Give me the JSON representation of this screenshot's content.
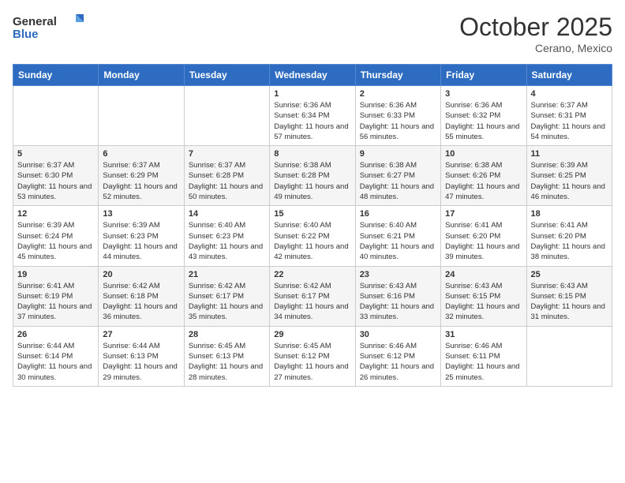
{
  "header": {
    "logo_line1": "General",
    "logo_line2": "Blue",
    "month": "October 2025",
    "location": "Cerano, Mexico"
  },
  "days_of_week": [
    "Sunday",
    "Monday",
    "Tuesday",
    "Wednesday",
    "Thursday",
    "Friday",
    "Saturday"
  ],
  "weeks": [
    [
      {
        "day": "",
        "sunrise": "",
        "sunset": "",
        "daylight": ""
      },
      {
        "day": "",
        "sunrise": "",
        "sunset": "",
        "daylight": ""
      },
      {
        "day": "",
        "sunrise": "",
        "sunset": "",
        "daylight": ""
      },
      {
        "day": "1",
        "sunrise": "Sunrise: 6:36 AM",
        "sunset": "Sunset: 6:34 PM",
        "daylight": "Daylight: 11 hours and 57 minutes."
      },
      {
        "day": "2",
        "sunrise": "Sunrise: 6:36 AM",
        "sunset": "Sunset: 6:33 PM",
        "daylight": "Daylight: 11 hours and 56 minutes."
      },
      {
        "day": "3",
        "sunrise": "Sunrise: 6:36 AM",
        "sunset": "Sunset: 6:32 PM",
        "daylight": "Daylight: 11 hours and 55 minutes."
      },
      {
        "day": "4",
        "sunrise": "Sunrise: 6:37 AM",
        "sunset": "Sunset: 6:31 PM",
        "daylight": "Daylight: 11 hours and 54 minutes."
      }
    ],
    [
      {
        "day": "5",
        "sunrise": "Sunrise: 6:37 AM",
        "sunset": "Sunset: 6:30 PM",
        "daylight": "Daylight: 11 hours and 53 minutes."
      },
      {
        "day": "6",
        "sunrise": "Sunrise: 6:37 AM",
        "sunset": "Sunset: 6:29 PM",
        "daylight": "Daylight: 11 hours and 52 minutes."
      },
      {
        "day": "7",
        "sunrise": "Sunrise: 6:37 AM",
        "sunset": "Sunset: 6:28 PM",
        "daylight": "Daylight: 11 hours and 50 minutes."
      },
      {
        "day": "8",
        "sunrise": "Sunrise: 6:38 AM",
        "sunset": "Sunset: 6:28 PM",
        "daylight": "Daylight: 11 hours and 49 minutes."
      },
      {
        "day": "9",
        "sunrise": "Sunrise: 6:38 AM",
        "sunset": "Sunset: 6:27 PM",
        "daylight": "Daylight: 11 hours and 48 minutes."
      },
      {
        "day": "10",
        "sunrise": "Sunrise: 6:38 AM",
        "sunset": "Sunset: 6:26 PM",
        "daylight": "Daylight: 11 hours and 47 minutes."
      },
      {
        "day": "11",
        "sunrise": "Sunrise: 6:39 AM",
        "sunset": "Sunset: 6:25 PM",
        "daylight": "Daylight: 11 hours and 46 minutes."
      }
    ],
    [
      {
        "day": "12",
        "sunrise": "Sunrise: 6:39 AM",
        "sunset": "Sunset: 6:24 PM",
        "daylight": "Daylight: 11 hours and 45 minutes."
      },
      {
        "day": "13",
        "sunrise": "Sunrise: 6:39 AM",
        "sunset": "Sunset: 6:23 PM",
        "daylight": "Daylight: 11 hours and 44 minutes."
      },
      {
        "day": "14",
        "sunrise": "Sunrise: 6:40 AM",
        "sunset": "Sunset: 6:23 PM",
        "daylight": "Daylight: 11 hours and 43 minutes."
      },
      {
        "day": "15",
        "sunrise": "Sunrise: 6:40 AM",
        "sunset": "Sunset: 6:22 PM",
        "daylight": "Daylight: 11 hours and 42 minutes."
      },
      {
        "day": "16",
        "sunrise": "Sunrise: 6:40 AM",
        "sunset": "Sunset: 6:21 PM",
        "daylight": "Daylight: 11 hours and 40 minutes."
      },
      {
        "day": "17",
        "sunrise": "Sunrise: 6:41 AM",
        "sunset": "Sunset: 6:20 PM",
        "daylight": "Daylight: 11 hours and 39 minutes."
      },
      {
        "day": "18",
        "sunrise": "Sunrise: 6:41 AM",
        "sunset": "Sunset: 6:20 PM",
        "daylight": "Daylight: 11 hours and 38 minutes."
      }
    ],
    [
      {
        "day": "19",
        "sunrise": "Sunrise: 6:41 AM",
        "sunset": "Sunset: 6:19 PM",
        "daylight": "Daylight: 11 hours and 37 minutes."
      },
      {
        "day": "20",
        "sunrise": "Sunrise: 6:42 AM",
        "sunset": "Sunset: 6:18 PM",
        "daylight": "Daylight: 11 hours and 36 minutes."
      },
      {
        "day": "21",
        "sunrise": "Sunrise: 6:42 AM",
        "sunset": "Sunset: 6:17 PM",
        "daylight": "Daylight: 11 hours and 35 minutes."
      },
      {
        "day": "22",
        "sunrise": "Sunrise: 6:42 AM",
        "sunset": "Sunset: 6:17 PM",
        "daylight": "Daylight: 11 hours and 34 minutes."
      },
      {
        "day": "23",
        "sunrise": "Sunrise: 6:43 AM",
        "sunset": "Sunset: 6:16 PM",
        "daylight": "Daylight: 11 hours and 33 minutes."
      },
      {
        "day": "24",
        "sunrise": "Sunrise: 6:43 AM",
        "sunset": "Sunset: 6:15 PM",
        "daylight": "Daylight: 11 hours and 32 minutes."
      },
      {
        "day": "25",
        "sunrise": "Sunrise: 6:43 AM",
        "sunset": "Sunset: 6:15 PM",
        "daylight": "Daylight: 11 hours and 31 minutes."
      }
    ],
    [
      {
        "day": "26",
        "sunrise": "Sunrise: 6:44 AM",
        "sunset": "Sunset: 6:14 PM",
        "daylight": "Daylight: 11 hours and 30 minutes."
      },
      {
        "day": "27",
        "sunrise": "Sunrise: 6:44 AM",
        "sunset": "Sunset: 6:13 PM",
        "daylight": "Daylight: 11 hours and 29 minutes."
      },
      {
        "day": "28",
        "sunrise": "Sunrise: 6:45 AM",
        "sunset": "Sunset: 6:13 PM",
        "daylight": "Daylight: 11 hours and 28 minutes."
      },
      {
        "day": "29",
        "sunrise": "Sunrise: 6:45 AM",
        "sunset": "Sunset: 6:12 PM",
        "daylight": "Daylight: 11 hours and 27 minutes."
      },
      {
        "day": "30",
        "sunrise": "Sunrise: 6:46 AM",
        "sunset": "Sunset: 6:12 PM",
        "daylight": "Daylight: 11 hours and 26 minutes."
      },
      {
        "day": "31",
        "sunrise": "Sunrise: 6:46 AM",
        "sunset": "Sunset: 6:11 PM",
        "daylight": "Daylight: 11 hours and 25 minutes."
      },
      {
        "day": "",
        "sunrise": "",
        "sunset": "",
        "daylight": ""
      }
    ]
  ]
}
